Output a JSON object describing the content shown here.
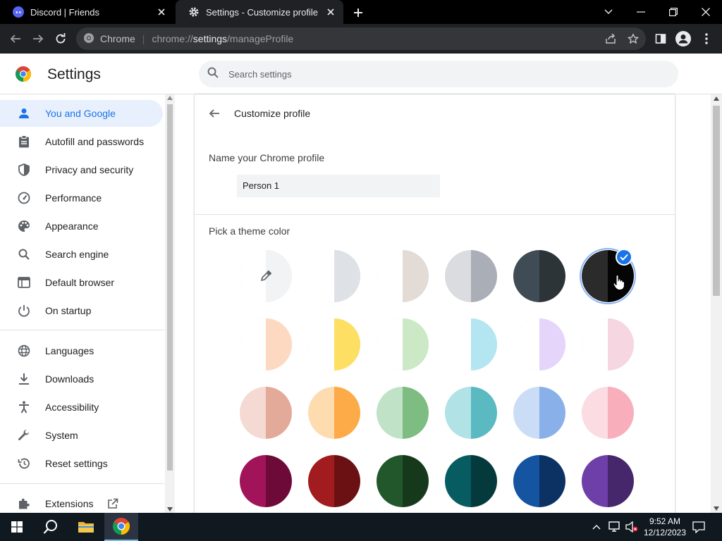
{
  "browser": {
    "tabs": [
      {
        "title": "Discord | Friends",
        "active": false
      },
      {
        "title": "Settings - Customize profile",
        "active": true
      }
    ],
    "omnibox": {
      "site_label": "Chrome",
      "url_scheme": "chrome://",
      "url_host": "settings",
      "url_path": "/manageProfile"
    }
  },
  "header": {
    "title": "Settings",
    "search_placeholder": "Search settings"
  },
  "sidebar": {
    "items": [
      {
        "label": "You and Google",
        "icon": "person-icon",
        "selected": true
      },
      {
        "label": "Autofill and passwords",
        "icon": "clipboard-icon"
      },
      {
        "label": "Privacy and security",
        "icon": "shield-icon"
      },
      {
        "label": "Performance",
        "icon": "speedometer-icon"
      },
      {
        "label": "Appearance",
        "icon": "palette-icon"
      },
      {
        "label": "Search engine",
        "icon": "search-icon"
      },
      {
        "label": "Default browser",
        "icon": "browser-window-icon"
      },
      {
        "label": "On startup",
        "icon": "power-icon"
      },
      {
        "label": "Languages",
        "icon": "globe-icon"
      },
      {
        "label": "Downloads",
        "icon": "download-icon"
      },
      {
        "label": "Accessibility",
        "icon": "accessibility-icon"
      },
      {
        "label": "System",
        "icon": "wrench-icon"
      },
      {
        "label": "Reset settings",
        "icon": "reset-history-icon"
      },
      {
        "label": "Extensions",
        "icon": "puzzle-icon"
      }
    ]
  },
  "main": {
    "heading": "Customize profile",
    "name_label": "Name your Chrome profile",
    "name_value": "Person 1",
    "theme_label": "Pick a theme color",
    "swatches": [
      {
        "left": "#ffffff",
        "right": "#f1f3f4",
        "picker": true
      },
      {
        "left": "#ffffff",
        "right": "#dee1e6"
      },
      {
        "left": "#ffffff",
        "right": "#e3dcd6"
      },
      {
        "left": "#dadce0",
        "right": "#aaaeb6"
      },
      {
        "left": "#3f4c56",
        "right": "#2d3438"
      },
      {
        "left": "#2b2b2b",
        "right": "#050505",
        "selected": true
      },
      {
        "left": "#ffffff",
        "right": "#fdd9c2"
      },
      {
        "left": "#ffffff",
        "right": "#fde063"
      },
      {
        "left": "#ffffff",
        "right": "#cbe9c4"
      },
      {
        "left": "#ffffff",
        "right": "#b3e6f0"
      },
      {
        "left": "#ffffff",
        "right": "#e6d5fa"
      },
      {
        "left": "#ffffff",
        "right": "#f6d6e0"
      },
      {
        "left": "#f4dad2",
        "right": "#e3a999"
      },
      {
        "left": "#fedcb0",
        "right": "#fcab48"
      },
      {
        "left": "#c0e2c6",
        "right": "#7dbd82"
      },
      {
        "left": "#b1e2e5",
        "right": "#5ab9c1"
      },
      {
        "left": "#cbdcf6",
        "right": "#8ab0e9"
      },
      {
        "left": "#fcdce3",
        "right": "#f9aebc"
      },
      {
        "left": "#a21459",
        "right": "#6d0a38"
      },
      {
        "left": "#a11b1f",
        "right": "#6c1113"
      },
      {
        "left": "#22572c",
        "right": "#17391b"
      },
      {
        "left": "#075c61",
        "right": "#053a3d"
      },
      {
        "left": "#1454a1",
        "right": "#0c3264"
      },
      {
        "left": "#6e3fa8",
        "right": "#47276c"
      }
    ]
  },
  "taskbar": {
    "time": "9:52 AM",
    "date": "12/12/2023"
  }
}
